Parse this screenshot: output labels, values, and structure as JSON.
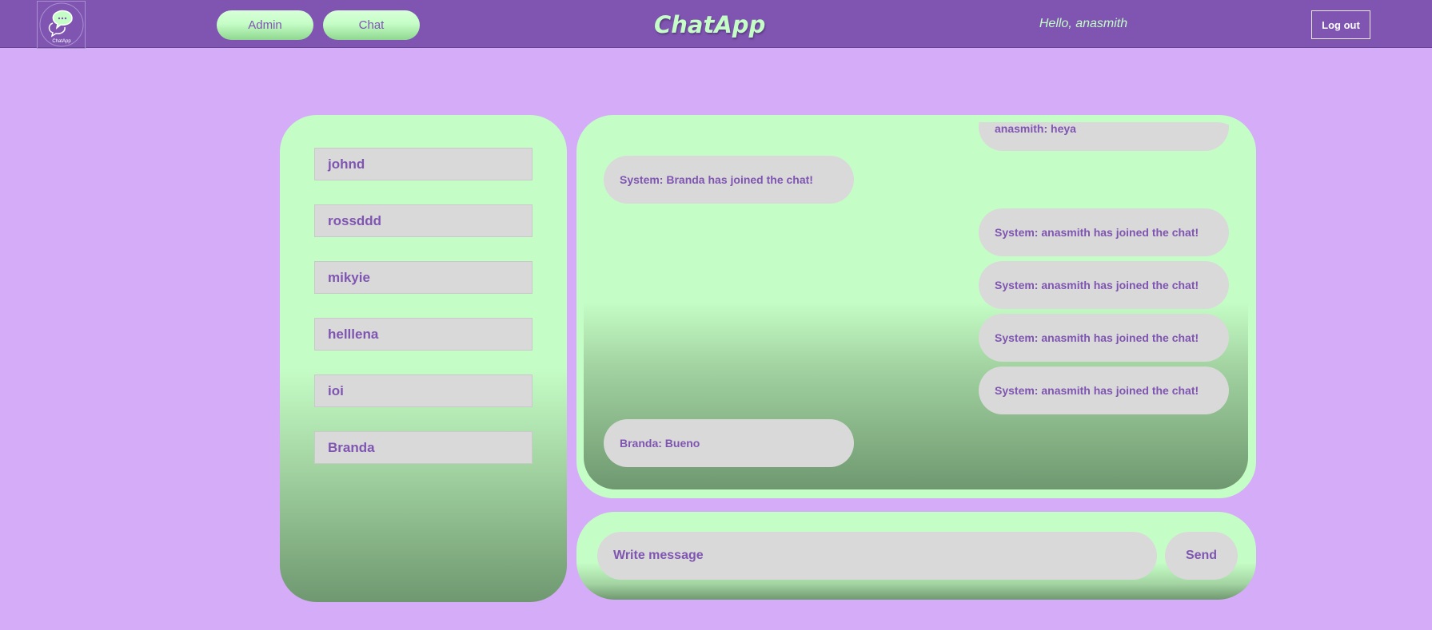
{
  "header": {
    "logo_text": "ChatApp",
    "nav": [
      {
        "label": "Admin"
      },
      {
        "label": "Chat"
      }
    ],
    "brand": "ChatApp",
    "greeting": "Hello, anasmith",
    "logout_label": "Log out"
  },
  "users": [
    {
      "name": "johnd"
    },
    {
      "name": "rossddd"
    },
    {
      "name": "mikyie"
    },
    {
      "name": "helllena"
    },
    {
      "name": "ioi"
    },
    {
      "name": "Branda"
    }
  ],
  "messages": [
    {
      "text": "anasmith: heya",
      "side": "right"
    },
    {
      "text": "System: Branda has joined the chat!",
      "side": "left"
    },
    {
      "text": "System: anasmith has joined the chat!",
      "side": "right"
    },
    {
      "text": "System: anasmith has joined the chat!",
      "side": "right"
    },
    {
      "text": "System: anasmith has joined the chat!",
      "side": "right"
    },
    {
      "text": "System: anasmith has joined the chat!",
      "side": "right"
    },
    {
      "text": "Branda: Bueno",
      "side": "left"
    }
  ],
  "composer": {
    "placeholder": "Write message",
    "send_label": "Send"
  },
  "colors": {
    "background": "#d4acf8",
    "header": "#7f55b1",
    "panel": "#c5fdc6",
    "bubble": "#d9d9d9",
    "text": "#7f55b1"
  },
  "icons": {
    "logo": "chat-bubbles-icon"
  }
}
